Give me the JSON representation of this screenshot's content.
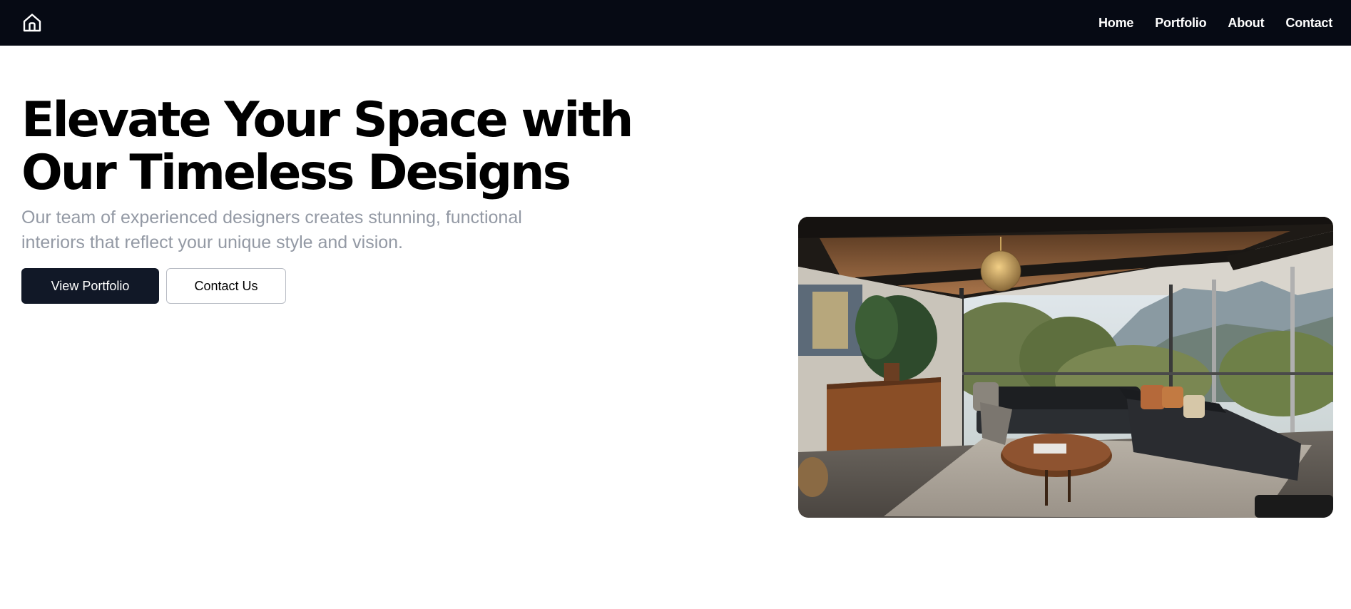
{
  "nav": {
    "logo_icon": "home-icon",
    "links": [
      {
        "label": "Home"
      },
      {
        "label": "Portfolio"
      },
      {
        "label": "About"
      },
      {
        "label": "Contact"
      }
    ]
  },
  "hero": {
    "title": "Elevate Your Space with Our Timeless Designs",
    "subtitle": "Our team of experienced designers creates stunning, functional interiors that reflect your unique style and vision.",
    "primary_button": "View Portfolio",
    "secondary_button": "Contact Us",
    "image": "living-room-photo"
  },
  "colors": {
    "nav_background": "#060a14",
    "primary_button": "#111827",
    "subtitle": "#9399a4"
  }
}
